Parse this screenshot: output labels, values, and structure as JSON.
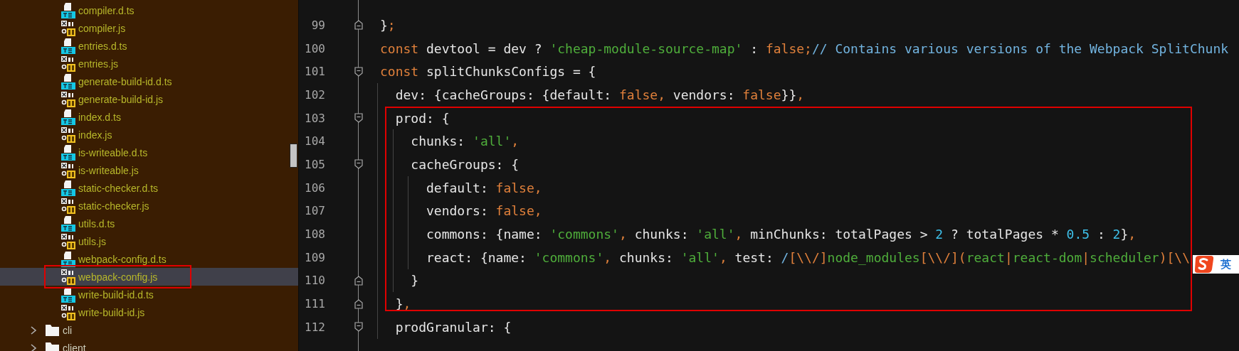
{
  "sidebar": {
    "files": [
      {
        "name": "compiler.d.ts",
        "kind": "ts",
        "selected": false
      },
      {
        "name": "compiler.js",
        "kind": "js",
        "selected": false
      },
      {
        "name": "entries.d.ts",
        "kind": "ts",
        "selected": false
      },
      {
        "name": "entries.js",
        "kind": "js",
        "selected": false
      },
      {
        "name": "generate-build-id.d.ts",
        "kind": "ts",
        "selected": false
      },
      {
        "name": "generate-build-id.js",
        "kind": "js",
        "selected": false
      },
      {
        "name": "index.d.ts",
        "kind": "ts",
        "selected": false
      },
      {
        "name": "index.js",
        "kind": "js",
        "selected": false
      },
      {
        "name": "is-writeable.d.ts",
        "kind": "ts",
        "selected": false
      },
      {
        "name": "is-writeable.js",
        "kind": "js",
        "selected": false
      },
      {
        "name": "static-checker.d.ts",
        "kind": "ts",
        "selected": false
      },
      {
        "name": "static-checker.js",
        "kind": "js",
        "selected": false
      },
      {
        "name": "utils.d.ts",
        "kind": "ts",
        "selected": false
      },
      {
        "name": "utils.js",
        "kind": "js",
        "selected": false
      },
      {
        "name": "webpack-config.d.ts",
        "kind": "ts",
        "selected": false
      },
      {
        "name": "webpack-config.js",
        "kind": "js",
        "selected": true
      },
      {
        "name": "write-build-id.d.ts",
        "kind": "ts",
        "selected": false
      },
      {
        "name": "write-build-id.js",
        "kind": "js",
        "selected": false
      }
    ],
    "folders": [
      {
        "name": "cli",
        "expanded": false
      },
      {
        "name": "client",
        "expanded": false
      }
    ]
  },
  "editor": {
    "lines": [
      {
        "number": "99",
        "fold_start": false,
        "fold_end": true,
        "tokens": [
          {
            "text": "}",
            "kind": "plain"
          },
          {
            "text": ";",
            "kind": "keyword"
          }
        ]
      },
      {
        "number": "100",
        "fold_start": false,
        "fold_end": false,
        "tokens": [
          {
            "text": "const",
            "kind": "keyword"
          },
          {
            "text": " devtool = dev ? ",
            "kind": "plain"
          },
          {
            "text": "'cheap-module-source-map'",
            "kind": "string"
          },
          {
            "text": " : ",
            "kind": "plain"
          },
          {
            "text": "false;",
            "kind": "keyword"
          },
          {
            "text": "// Contains various versions of the Webpack SplitChunk",
            "kind": "comment"
          }
        ]
      },
      {
        "number": "101",
        "fold_start": true,
        "fold_end": false,
        "tokens": [
          {
            "text": "const",
            "kind": "keyword"
          },
          {
            "text": " splitChunksConfigs = {",
            "kind": "plain"
          }
        ]
      },
      {
        "number": "102",
        "fold_start": false,
        "fold_end": false,
        "tokens": [
          {
            "text": "  dev: {cacheGroups: {default: ",
            "kind": "plain"
          },
          {
            "text": "false, ",
            "kind": "keyword"
          },
          {
            "text": "vendors: ",
            "kind": "plain"
          },
          {
            "text": "false",
            "kind": "keyword"
          },
          {
            "text": "}}",
            "kind": "plain"
          },
          {
            "text": ",",
            "kind": "keyword"
          }
        ]
      },
      {
        "number": "103",
        "fold_start": true,
        "fold_end": false,
        "tokens": [
          {
            "text": "  prod: {",
            "kind": "plain"
          }
        ]
      },
      {
        "number": "104",
        "fold_start": false,
        "fold_end": false,
        "tokens": [
          {
            "text": "    chunks: ",
            "kind": "plain"
          },
          {
            "text": "'all'",
            "kind": "string"
          },
          {
            "text": ",",
            "kind": "keyword"
          }
        ]
      },
      {
        "number": "105",
        "fold_start": true,
        "fold_end": false,
        "tokens": [
          {
            "text": "    cacheGroups: {",
            "kind": "plain"
          }
        ]
      },
      {
        "number": "106",
        "fold_start": false,
        "fold_end": false,
        "tokens": [
          {
            "text": "      default: ",
            "kind": "plain"
          },
          {
            "text": "false,",
            "kind": "keyword"
          }
        ]
      },
      {
        "number": "107",
        "fold_start": false,
        "fold_end": false,
        "tokens": [
          {
            "text": "      vendors: ",
            "kind": "plain"
          },
          {
            "text": "false,",
            "kind": "keyword"
          }
        ]
      },
      {
        "number": "108",
        "fold_start": false,
        "fold_end": false,
        "tokens": [
          {
            "text": "      commons: {name: ",
            "kind": "plain"
          },
          {
            "text": "'commons'",
            "kind": "string"
          },
          {
            "text": ",",
            "kind": "keyword"
          },
          {
            "text": " chunks: ",
            "kind": "plain"
          },
          {
            "text": "'all'",
            "kind": "string"
          },
          {
            "text": ",",
            "kind": "keyword"
          },
          {
            "text": " minChunks: totalPages > ",
            "kind": "plain"
          },
          {
            "text": "2",
            "kind": "number"
          },
          {
            "text": " ? totalPages * ",
            "kind": "plain"
          },
          {
            "text": "0.5",
            "kind": "number"
          },
          {
            "text": " : ",
            "kind": "plain"
          },
          {
            "text": "2",
            "kind": "number"
          },
          {
            "text": "}",
            "kind": "plain"
          },
          {
            "text": ",",
            "kind": "keyword"
          }
        ]
      },
      {
        "number": "109",
        "fold_start": false,
        "fold_end": false,
        "tokens": [
          {
            "text": "      react: {name: ",
            "kind": "plain"
          },
          {
            "text": "'commons'",
            "kind": "string"
          },
          {
            "text": ",",
            "kind": "keyword"
          },
          {
            "text": " chunks: ",
            "kind": "plain"
          },
          {
            "text": "'all'",
            "kind": "string"
          },
          {
            "text": ",",
            "kind": "keyword"
          },
          {
            "text": " test: ",
            "kind": "plain"
          },
          {
            "text": "/",
            "kind": "comment"
          },
          {
            "text": "[\\\\/]",
            "kind": "keyword"
          },
          {
            "text": "node_modules",
            "kind": "string"
          },
          {
            "text": "[\\\\/](",
            "kind": "keyword"
          },
          {
            "text": "react",
            "kind": "string"
          },
          {
            "text": "|",
            "kind": "keyword"
          },
          {
            "text": "react-dom",
            "kind": "string"
          },
          {
            "text": "|",
            "kind": "keyword"
          },
          {
            "text": "scheduler",
            "kind": "string"
          },
          {
            "text": ")[\\\\",
            "kind": "keyword"
          }
        ]
      },
      {
        "number": "110",
        "fold_start": false,
        "fold_end": true,
        "tokens": [
          {
            "text": "    }",
            "kind": "plain"
          }
        ]
      },
      {
        "number": "111",
        "fold_start": false,
        "fold_end": true,
        "tokens": [
          {
            "text": "  }",
            "kind": "plain"
          },
          {
            "text": ",",
            "kind": "keyword"
          }
        ]
      },
      {
        "number": "112",
        "fold_start": true,
        "fold_end": false,
        "tokens": [
          {
            "text": "  prodGranular: {",
            "kind": "plain"
          }
        ]
      }
    ]
  },
  "ime_indicator": {
    "label": "英"
  }
}
